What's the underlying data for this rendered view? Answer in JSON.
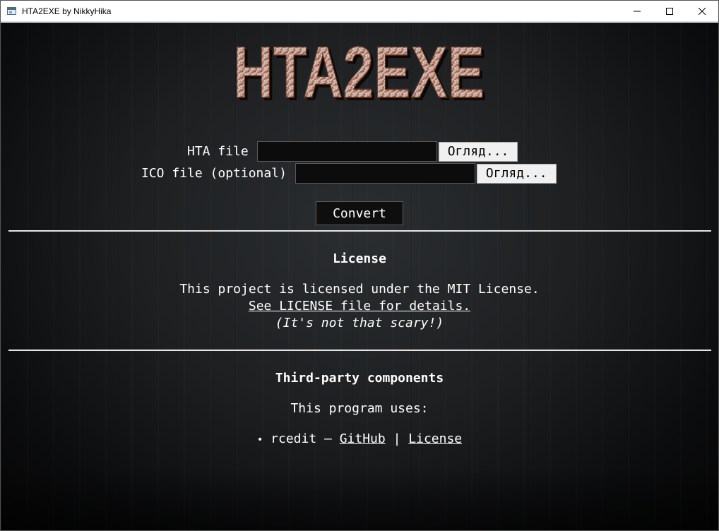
{
  "window": {
    "title": "HTA2EXE by NikkyHika"
  },
  "logo": {
    "text": "HTA2EXE"
  },
  "form": {
    "hta_label": "HTA file",
    "hta_value": "",
    "hta_browse": "Огляд...",
    "ico_label": "ICO file (optional)",
    "ico_value": "",
    "ico_browse": "Огляд...",
    "convert": "Convert"
  },
  "license": {
    "title": "License",
    "line1": "This project is licensed under the MIT License.",
    "link": "See LICENSE file for details.",
    "note": "(It's not that scary!)"
  },
  "third_party": {
    "title": "Third-party components",
    "uses": "This program uses:",
    "items": [
      {
        "bullet": "•",
        "name": "rcedit",
        "dash": "—",
        "github": "GitHub",
        "sep": "|",
        "license": "License"
      }
    ]
  },
  "colors": {
    "background": "#1d1f21",
    "logo_rust": "#b0644a",
    "logo_metal": "#c8c8c8"
  }
}
